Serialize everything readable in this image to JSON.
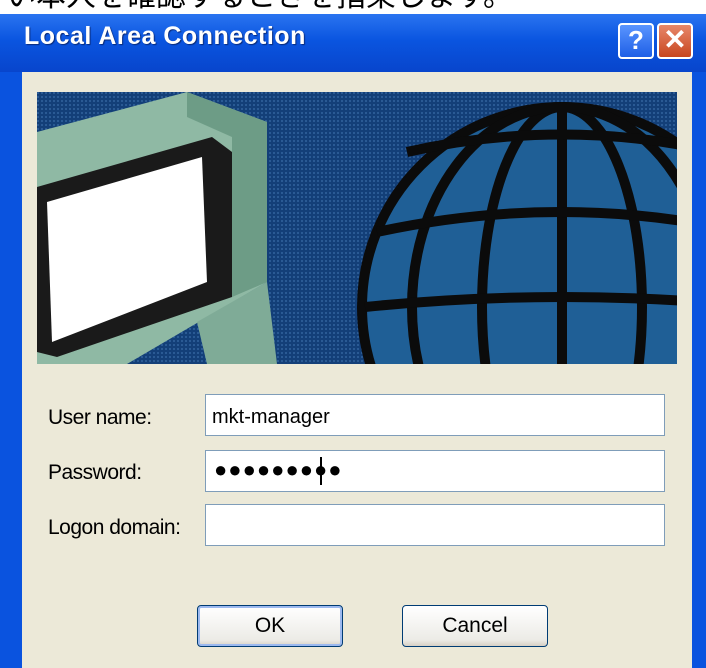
{
  "caption": "い本人を確認するときを指架します。",
  "window": {
    "title": "Local Area Connection",
    "help_glyph": "?",
    "close_glyph": "✕"
  },
  "form": {
    "username_label": "User name:",
    "username_value": "mkt-manager",
    "password_label": "Password:",
    "password_masked": "●●●●●●●●●",
    "domain_label": "Logon domain:",
    "domain_value": ""
  },
  "buttons": {
    "ok_label": "OK",
    "cancel_label": "Cancel"
  },
  "colors": {
    "titlebar": "#0a55e0",
    "client": "#ece9d8",
    "globe": "#1f5f96",
    "banner": "#123c72"
  },
  "icons": [
    "help-icon",
    "close-icon",
    "computer-monitor-icon",
    "globe-icon"
  ]
}
